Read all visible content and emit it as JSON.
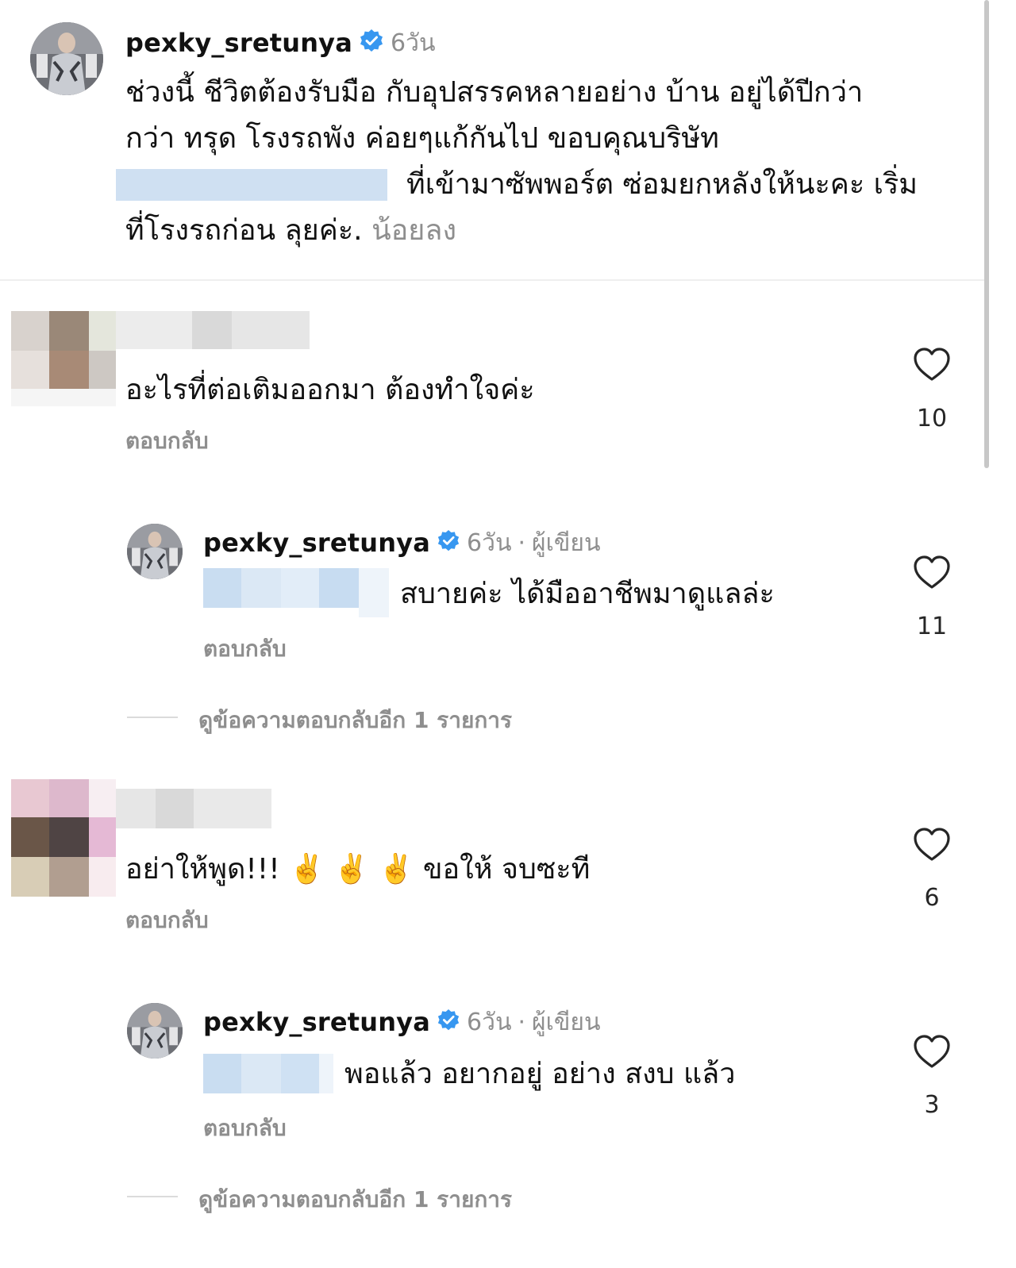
{
  "post": {
    "username": "pexky_sretunya",
    "time": "6วัน",
    "caption_line1": "ช่วงนี้ ชีวิตต้องรับมือ กับอุปสรรคหลายอย่าง  บ้าน อยู่ได้ปีกว่า",
    "caption_line2": "กว่า ทรุด โรงรถพัง  ค่อยๆแก้กันไป  ขอบคุณบริษัท",
    "caption_line3": "ที่เข้ามาซัพพอร์ต ซ่อมยกหลังให้นะคะ เริ่ม",
    "caption_line4": "ที่โรงรถก่อน ลุยค่ะ.",
    "see_less": "น้อยลง"
  },
  "comments": [
    {
      "text": "อะไรที่ต่อเติมออกมา ต้องทำใจค่ะ",
      "reply_label": "ตอบกลับ",
      "likes": "10",
      "replies": [
        {
          "username": "pexky_sretunya",
          "time": "6วัน",
          "author_label": "ผู้เขียน",
          "text": "สบายค่ะ  ได้มืออาชีพมาดูแลล่ะ",
          "reply_label": "ตอบกลับ",
          "likes": "11"
        }
      ],
      "view_more": "ดูข้อความตอบกลับอีก 1 รายการ"
    },
    {
      "text": "อย่าให้พูด!!! ✌️ ✌️ ✌️  ขอให้ จบซะที",
      "reply_label": "ตอบกลับ",
      "likes": "6",
      "replies": [
        {
          "username": "pexky_sretunya",
          "time": "6วัน",
          "author_label": "ผู้เขียน",
          "text": "พอแล้ว  อยากอยู่ อย่าง สงบ แล้ว",
          "reply_label": "ตอบกลับ",
          "likes": "3"
        }
      ],
      "view_more": "ดูข้อความตอบกลับอีก 1 รายการ"
    }
  ],
  "colors": {
    "verified": "#3797f0",
    "muted": "#8e8e8e",
    "redaction": "#cfe0f2"
  }
}
